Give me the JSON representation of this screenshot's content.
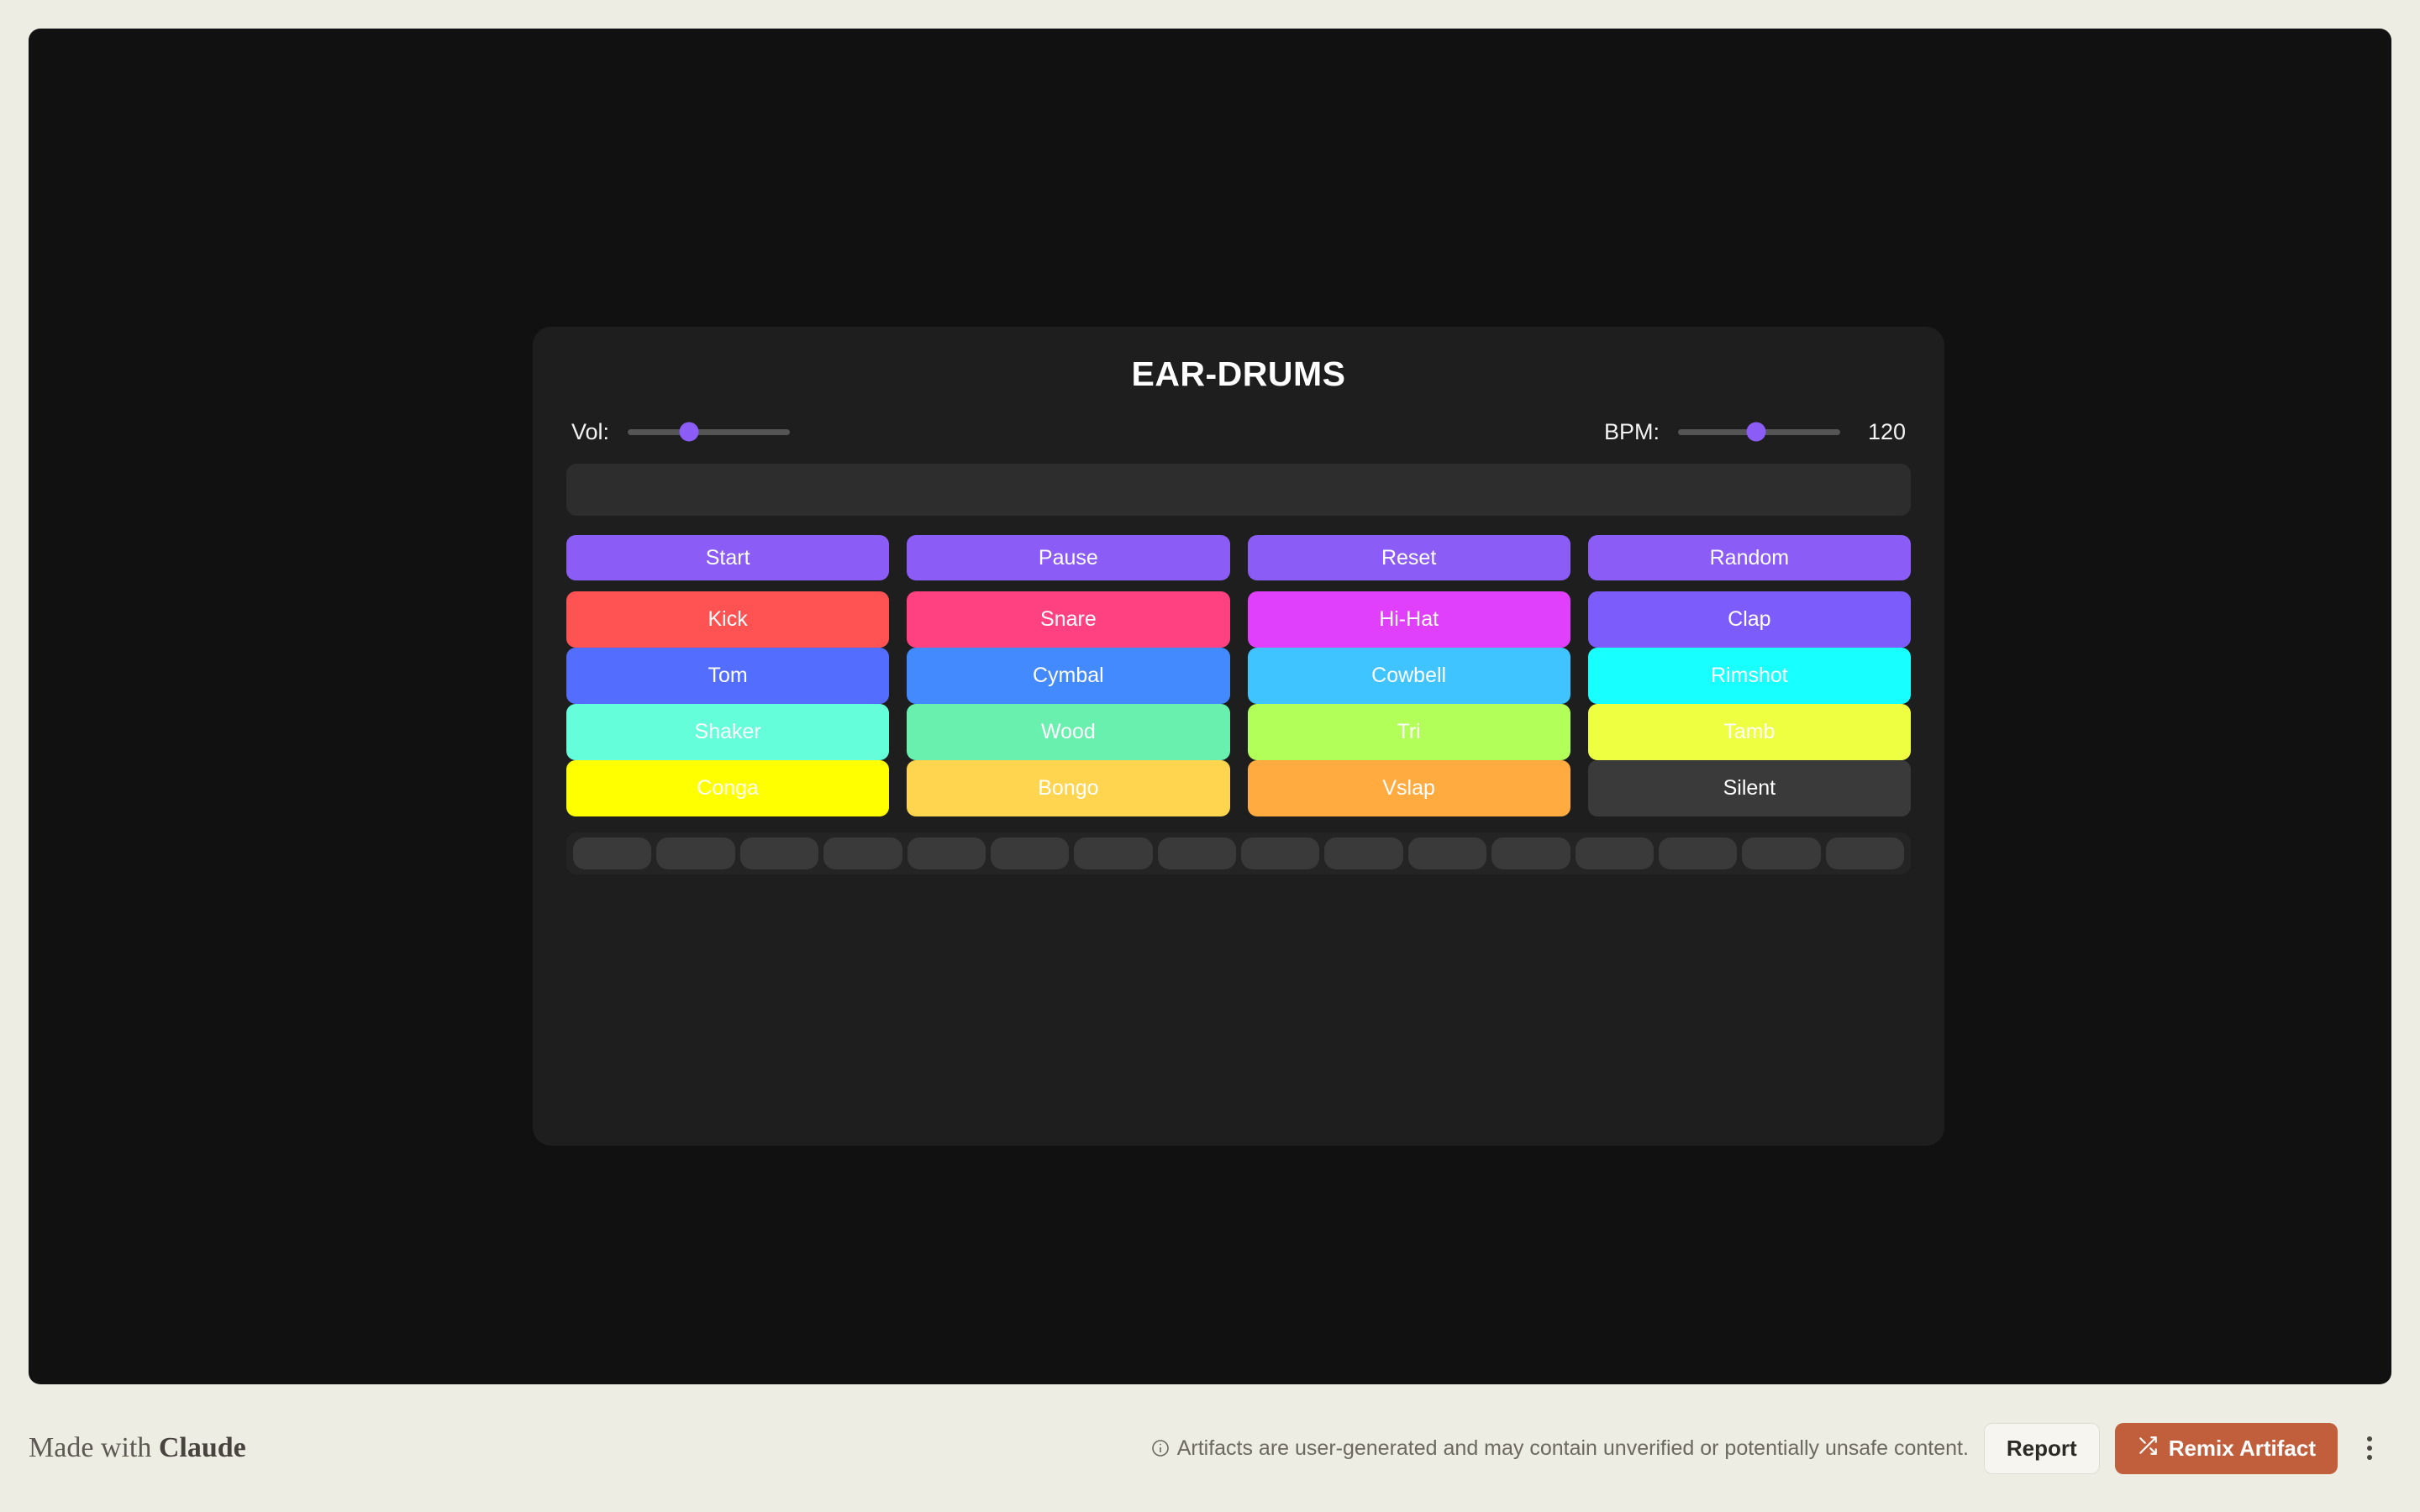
{
  "app": {
    "title": "EAR-DRUMS",
    "panel_bg": "#1E1E1E",
    "canvas_bg": "#111111",
    "page_bg": "#EEEDE4",
    "accent": "#8B5CF6"
  },
  "controls": {
    "volume": {
      "label": "Vol:",
      "value_percent": 38,
      "track_color": "#555555",
      "thumb_color": "#8B5CF6"
    },
    "bpm": {
      "label": "BPM:",
      "value": "120",
      "value_percent": 48,
      "track_color": "#555555",
      "thumb_color": "#8B5CF6"
    }
  },
  "display": {
    "text": "",
    "bg": "#2D2D2D"
  },
  "transport_buttons": [
    {
      "label": "Start",
      "color": "#8B5CF6"
    },
    {
      "label": "Pause",
      "color": "#8B5CF6"
    },
    {
      "label": "Reset",
      "color": "#8B5CF6"
    },
    {
      "label": "Random",
      "color": "#8B5CF6"
    }
  ],
  "sound_pads": [
    {
      "label": "Kick",
      "color": "#FF5252"
    },
    {
      "label": "Snare",
      "color": "#FF4081"
    },
    {
      "label": "Hi-Hat",
      "color": "#E040FB"
    },
    {
      "label": "Clap",
      "color": "#7C5CFA"
    },
    {
      "label": "Tom",
      "color": "#536DFE"
    },
    {
      "label": "Cymbal",
      "color": "#448AFF"
    },
    {
      "label": "Cowbell",
      "color": "#40C4FF"
    },
    {
      "label": "Rimshot",
      "color": "#18FFFF"
    },
    {
      "label": "Shaker",
      "color": "#64FFDA"
    },
    {
      "label": "Wood",
      "color": "#69F0AE"
    },
    {
      "label": "Tri",
      "color": "#B2FF59"
    },
    {
      "label": "Tamb",
      "color": "#EEFF41"
    },
    {
      "label": "Conga",
      "color": "#FFFF00"
    },
    {
      "label": "Bongo",
      "color": "#FFD54F"
    },
    {
      "label": "Vslap",
      "color": "#FFAB40"
    },
    {
      "label": "Silent",
      "color": "#3A3A3A"
    }
  ],
  "step_sequencer": {
    "step_count": 16,
    "inactive_color": "#3A3A3A",
    "steps_active": [
      false,
      false,
      false,
      false,
      false,
      false,
      false,
      false,
      false,
      false,
      false,
      false,
      false,
      false,
      false,
      false
    ]
  },
  "footer": {
    "made_with_prefix": "Made with ",
    "brand": "Claude",
    "disclaimer": "Artifacts are user-generated and may contain unverified or potentially unsafe content.",
    "report_label": "Report",
    "remix_label": "Remix Artifact",
    "remix_color": "#C15F3C"
  }
}
